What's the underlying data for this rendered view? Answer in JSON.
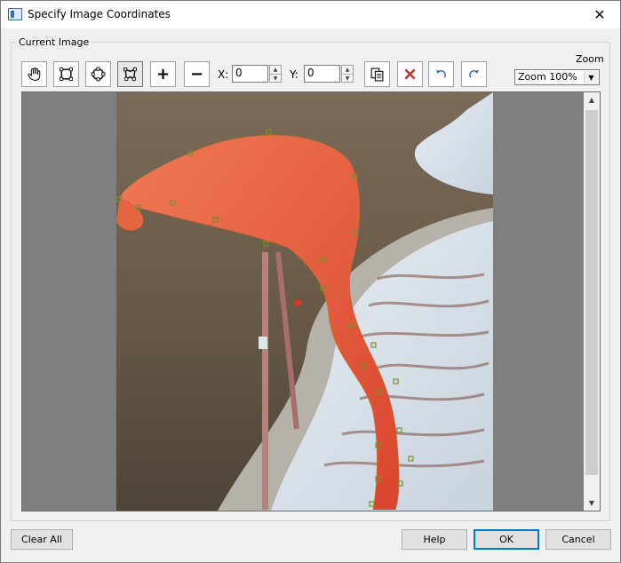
{
  "window": {
    "title": "Specify Image Coordinates",
    "close_glyph": "✕"
  },
  "group": {
    "label": "Current Image"
  },
  "toolbar": {
    "tools": [
      {
        "name": "pan-hand-icon"
      },
      {
        "name": "rectangle-shape-icon"
      },
      {
        "name": "circle-shape-icon"
      },
      {
        "name": "polygon-shape-icon"
      },
      {
        "name": "add-point-icon",
        "glyph": "+"
      },
      {
        "name": "remove-point-icon",
        "glyph": "−"
      }
    ],
    "x_label": "X:",
    "x_value": "0",
    "y_label": "Y:",
    "y_value": "0",
    "action_icons": [
      "copy-icon",
      "delete-icon",
      "undo-icon",
      "redo-icon"
    ],
    "delete_color": "#c0392b",
    "undo_color": "#2b5fa8"
  },
  "zoom": {
    "label": "Zoom",
    "value": "Zoom 100%"
  },
  "buttons": {
    "clear_all": "Clear All",
    "help": "Help",
    "ok": "OK",
    "cancel": "Cancel"
  },
  "colors": {
    "overlay_point": "#7a8f2a",
    "flamingo": "#e8573c"
  }
}
